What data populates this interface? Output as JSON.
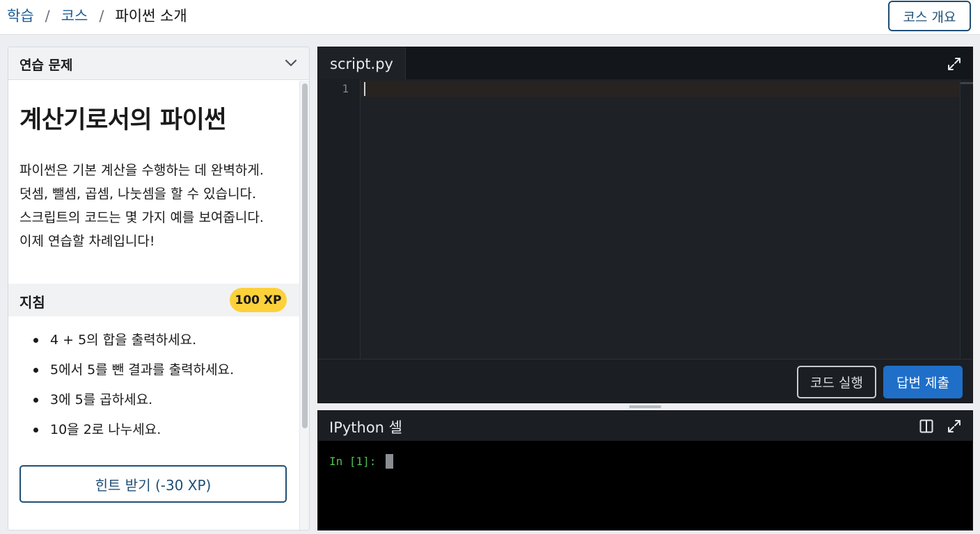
{
  "breadcrumb": {
    "items": [
      "학습",
      "코스"
    ],
    "current": "파이썬 소개",
    "separator": "/"
  },
  "header": {
    "overview_button": "코스 개요"
  },
  "exercise_panel": {
    "header_title": "연습 문제",
    "title": "계산기로서의 파이썬",
    "description_lines": [
      "파이썬은 기본 계산을 수행하는 데 완벽하게.",
      "덧셈, 뺄셈, 곱셈, 나눗셈을 할 수 있습니다.",
      "스크립트의 코드는 몇 가지 예를 보여줍니다.",
      "이제 연습할 차례입니다!"
    ],
    "instructions_title": "지침",
    "xp_badge": "100 XP",
    "instructions": [
      "4 + 5의 합을 출력하세요.",
      "5에서 5를 뺀 결과를 출력하세요.",
      "3에 5를 곱하세요.",
      "10을 2로 나누세요."
    ],
    "hint_button": "힌트 받기 (-30 XP)"
  },
  "editor": {
    "tab_label": "script.py",
    "line_numbers": [
      "1"
    ],
    "code": "",
    "run_button": "코드 실행",
    "submit_button": "답변 제출"
  },
  "console": {
    "title": "IPython 셀",
    "prompt": "In [1]:"
  },
  "colors": {
    "brand_blue": "#1f4f75",
    "submit_blue": "#1f6fc8",
    "xp_yellow": "#fcd13a",
    "prompt_green": "#4fbf52",
    "editor_bg": "#1e2126"
  },
  "icons": {
    "panel_toggle": "chevron-down-icon",
    "editor_expand": "expand-icon",
    "console_layout": "split-panel-icon",
    "console_expand": "expand-icon"
  }
}
